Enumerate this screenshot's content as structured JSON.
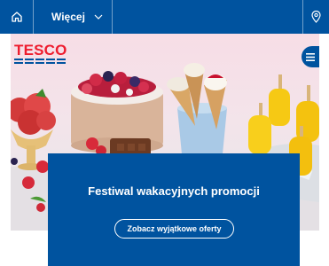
{
  "nav": {
    "more_label": "Więcej",
    "icons": {
      "home": "home-icon",
      "chevron": "chevron-down-icon",
      "location": "location-pin-icon",
      "menu": "hamburger-menu-icon"
    }
  },
  "brand": {
    "logo_text": "TESCO"
  },
  "promo": {
    "title": "Festiwal wakacyjnych promocji",
    "cta_label": "Zobacz wyjątkowe oferty"
  },
  "colors": {
    "brand_blue": "#00539f",
    "brand_red": "#ee1c2e",
    "white": "#ffffff"
  }
}
